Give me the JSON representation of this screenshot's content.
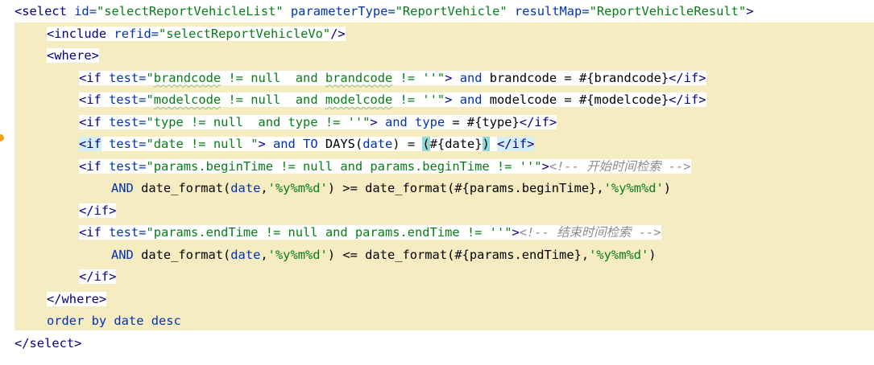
{
  "editor": {
    "language": "xml",
    "lines": [
      {
        "indent": 0,
        "bg": "white",
        "tokens": [
          {
            "cls": "tag",
            "t": "<select"
          },
          {
            "cls": "text",
            "t": " "
          },
          {
            "cls": "attr",
            "t": "id="
          },
          {
            "cls": "str",
            "t": "\"selectReportVehicleList\""
          },
          {
            "cls": "text",
            "t": " "
          },
          {
            "cls": "attr",
            "t": "parameterType="
          },
          {
            "cls": "str",
            "t": "\"ReportVehicle\""
          },
          {
            "cls": "text",
            "t": " "
          },
          {
            "cls": "attr",
            "t": "resultMap="
          },
          {
            "cls": "str",
            "t": "\"ReportVehicleResult\""
          },
          {
            "cls": "tag",
            "t": ">"
          }
        ]
      },
      {
        "indent": 1,
        "bg": "white",
        "tokens": [
          {
            "cls": "tag",
            "t": "<include"
          },
          {
            "cls": "text",
            "t": " "
          },
          {
            "cls": "attr",
            "t": "refid="
          },
          {
            "cls": "str",
            "t": "\"selectReportVehicleVo\""
          },
          {
            "cls": "tag",
            "t": "/>"
          }
        ]
      },
      {
        "indent": 1,
        "bg": "white",
        "tokens": [
          {
            "cls": "tag",
            "t": "<where>"
          }
        ]
      },
      {
        "indent": 2,
        "bg": "white",
        "tokens": [
          {
            "cls": "tag",
            "t": "<if"
          },
          {
            "cls": "text",
            "t": " "
          },
          {
            "cls": "attr",
            "t": "test="
          },
          {
            "cls": "str",
            "t": "\""
          },
          {
            "cls": "str wavy",
            "t": "brandcode"
          },
          {
            "cls": "str",
            "t": " != null  and "
          },
          {
            "cls": "str wavy",
            "t": "brandcode"
          },
          {
            "cls": "str",
            "t": " != ''\""
          },
          {
            "cls": "tag",
            "t": ">"
          },
          {
            "cls": "kw",
            "t": " and "
          },
          {
            "cls": "text",
            "t": "brandcode = #{brandcode}"
          },
          {
            "cls": "tag",
            "t": "</if>"
          }
        ]
      },
      {
        "indent": 2,
        "bg": "white",
        "tokens": [
          {
            "cls": "tag",
            "t": "<if"
          },
          {
            "cls": "text",
            "t": " "
          },
          {
            "cls": "attr",
            "t": "test="
          },
          {
            "cls": "str",
            "t": "\""
          },
          {
            "cls": "str wavy",
            "t": "modelcode"
          },
          {
            "cls": "str",
            "t": " != null  and "
          },
          {
            "cls": "str wavy",
            "t": "modelcode"
          },
          {
            "cls": "str",
            "t": " != ''\""
          },
          {
            "cls": "tag",
            "t": ">"
          },
          {
            "cls": "kw",
            "t": " and "
          },
          {
            "cls": "text",
            "t": "modelcode = #{modelcode}"
          },
          {
            "cls": "tag",
            "t": "</if>"
          }
        ]
      },
      {
        "indent": 2,
        "bg": "white",
        "tokens": [
          {
            "cls": "tag",
            "t": "<if"
          },
          {
            "cls": "text",
            "t": " "
          },
          {
            "cls": "attr",
            "t": "test="
          },
          {
            "cls": "str",
            "t": "\"type != null  and type != ''\""
          },
          {
            "cls": "tag",
            "t": ">"
          },
          {
            "cls": "kw",
            "t": " and "
          },
          {
            "cls": "kw",
            "t": "type"
          },
          {
            "cls": "text",
            "t": " = #{type}"
          },
          {
            "cls": "tag",
            "t": "</if>"
          }
        ]
      },
      {
        "indent": 2,
        "bg": "white",
        "tokens": [
          {
            "cls": "tag hl-tag",
            "t": "<if"
          },
          {
            "cls": "text",
            "t": " "
          },
          {
            "cls": "attr",
            "t": "test="
          },
          {
            "cls": "str",
            "t": "\"date != null \""
          },
          {
            "cls": "tag",
            "t": ">"
          },
          {
            "cls": "kw",
            "t": " and "
          },
          {
            "cls": "kw",
            "t": "TO"
          },
          {
            "cls": "text",
            "t": " DAYS("
          },
          {
            "cls": "kw",
            "t": "date"
          },
          {
            "cls": "text",
            "t": ") = "
          },
          {
            "cls": "text hl-paren",
            "t": "("
          },
          {
            "cls": "text",
            "t": "#{date}"
          },
          {
            "cls": "text hl-paren",
            "t": ")"
          },
          {
            "cls": "text",
            "t": " "
          },
          {
            "cls": "tag hl-tag",
            "t": "</if>"
          }
        ]
      },
      {
        "indent": 2,
        "bg": "white",
        "tokens": [
          {
            "cls": "tag",
            "t": "<if"
          },
          {
            "cls": "text",
            "t": " "
          },
          {
            "cls": "attr",
            "t": "test="
          },
          {
            "cls": "str",
            "t": "\"params.beginTime != null and params.beginTime != ''\""
          },
          {
            "cls": "tag",
            "t": ">"
          },
          {
            "cls": "comment",
            "t": "<!-- 开始时间检索 -->"
          }
        ]
      },
      {
        "indent": 3,
        "bg": "none",
        "tokens": [
          {
            "cls": "kw",
            "t": "AND"
          },
          {
            "cls": "text",
            "t": " date_format("
          },
          {
            "cls": "kw",
            "t": "date"
          },
          {
            "cls": "text",
            "t": ","
          },
          {
            "cls": "str",
            "t": "'%y%m%d'"
          },
          {
            "cls": "text",
            "t": ") "
          },
          {
            "cls": "text",
            "t": ">="
          },
          {
            "cls": "text",
            "t": " date_format(#{params.beginTime},"
          },
          {
            "cls": "str",
            "t": "'%y%m%d'"
          },
          {
            "cls": "text",
            "t": ")"
          }
        ]
      },
      {
        "indent": 2,
        "bg": "white",
        "tokens": [
          {
            "cls": "tag",
            "t": "</if>"
          }
        ]
      },
      {
        "indent": 2,
        "bg": "white",
        "tokens": [
          {
            "cls": "tag",
            "t": "<if"
          },
          {
            "cls": "text",
            "t": " "
          },
          {
            "cls": "attr",
            "t": "test="
          },
          {
            "cls": "str",
            "t": "\"params.endTime != null and params.endTime != ''\""
          },
          {
            "cls": "tag",
            "t": ">"
          },
          {
            "cls": "comment",
            "t": "<!-- 结束时间检索 -->"
          }
        ]
      },
      {
        "indent": 3,
        "bg": "none",
        "tokens": [
          {
            "cls": "kw",
            "t": "AND"
          },
          {
            "cls": "text",
            "t": " date_format("
          },
          {
            "cls": "kw",
            "t": "date"
          },
          {
            "cls": "text",
            "t": ","
          },
          {
            "cls": "str",
            "t": "'%y%m%d'"
          },
          {
            "cls": "text",
            "t": ") "
          },
          {
            "cls": "text",
            "t": "<="
          },
          {
            "cls": "text",
            "t": " date_format(#{params.endTime},"
          },
          {
            "cls": "str",
            "t": "'%y%m%d'"
          },
          {
            "cls": "text",
            "t": ")"
          }
        ]
      },
      {
        "indent": 2,
        "bg": "white",
        "tokens": [
          {
            "cls": "tag",
            "t": "</if>"
          }
        ]
      },
      {
        "indent": 1,
        "bg": "white",
        "tokens": [
          {
            "cls": "tag",
            "t": "</where>"
          }
        ]
      },
      {
        "indent": 1,
        "bg": "none",
        "tokens": [
          {
            "cls": "kw",
            "t": "order by date desc"
          }
        ]
      },
      {
        "indent": 0,
        "bg": "white",
        "tokens": [
          {
            "cls": "tag",
            "t": "</select>"
          }
        ]
      }
    ]
  }
}
